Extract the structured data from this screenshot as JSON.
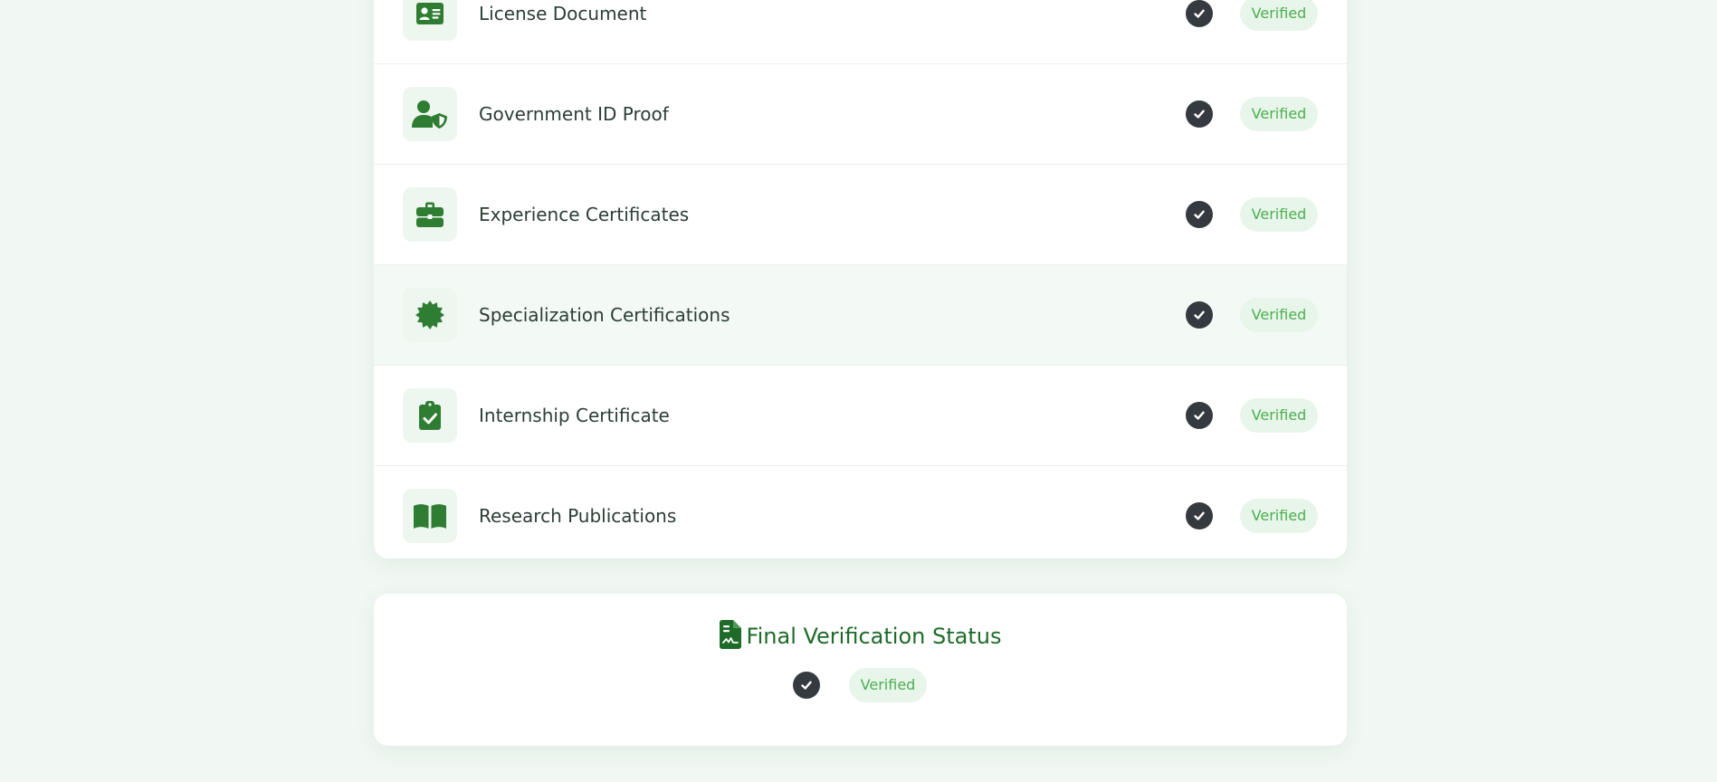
{
  "colors": {
    "page_background": "#f1f8f3",
    "accent_green": "#2e7d32",
    "title_green": "#1e6b2a",
    "badge_text": "#4caf50",
    "badge_background": "#e8f5ea",
    "check_circle": "#343a3f"
  },
  "documents": [
    {
      "label": "License Document",
      "icon": "id-card-icon",
      "status": "Verified"
    },
    {
      "label": "Government ID Proof",
      "icon": "user-shield-icon",
      "status": "Verified"
    },
    {
      "label": "Experience Certificates",
      "icon": "briefcase-icon",
      "status": "Verified"
    },
    {
      "label": "Specialization Certifications",
      "icon": "certificate-icon",
      "status": "Verified"
    },
    {
      "label": "Internship Certificate",
      "icon": "clipboard-check-icon",
      "status": "Verified"
    },
    {
      "label": "Research Publications",
      "icon": "book-open-icon",
      "status": "Verified"
    }
  ],
  "final_status": {
    "title": "Final Verification Status",
    "icon": "file-signature-icon",
    "status": "Verified"
  }
}
